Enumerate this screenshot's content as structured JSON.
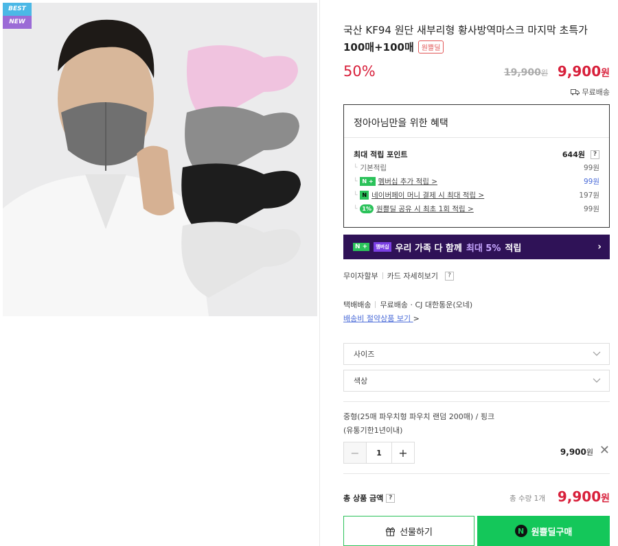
{
  "badges": {
    "best": "BEST",
    "new": "NEW"
  },
  "product": {
    "title_line1": "국산 KF94 원단 새부리형 황사방역마스크 마지막 초특가",
    "title_line2": "100매+100매",
    "tag": "원쁠딜",
    "discount": "50%",
    "original_price": "19,900",
    "original_unit": "원",
    "sale_price": "9,900",
    "sale_unit": "원",
    "shipping_badge": "무료배송"
  },
  "benefit": {
    "title": "정아아님만을 위한 혜택",
    "max_points_label": "최대 적립 포인트",
    "max_points_value": "644원",
    "help": "?",
    "rows": [
      {
        "label": "기본적립",
        "value": "99원"
      },
      {
        "label": "멤버십 추가 적립 >",
        "value": "99원",
        "pill": "N +"
      },
      {
        "label": "네이버페이 머니 결제 시 최대 적립 >",
        "value": "197원",
        "pill": "N"
      },
      {
        "label": "원쁠딜 공유 시 최초 1회 적립 >",
        "value": "99원",
        "pill": "1%"
      }
    ]
  },
  "banner": {
    "np": "N +",
    "mem": "멤버십",
    "text_pre": "우리 가족 다 함께",
    "text_hl": "최대 5%",
    "text_post": "적립",
    "chevron": "›"
  },
  "installment": {
    "label": "무이자할부",
    "link": "카드 자세히보기",
    "help": "?"
  },
  "delivery": {
    "label": "택배배송",
    "detail": "무료배송 · CJ 대한통운(오네)",
    "link": "배송비 절약상품 보기",
    "chevron": ">"
  },
  "options": {
    "size": "사이즈",
    "color": "색상"
  },
  "selected_option": {
    "line1": "중형(25매 파우치형 파우치 랜덤 200매) / 핑크",
    "line2": "(유통기한1년이내)",
    "minus": "−",
    "plus": "+",
    "quantity": "1",
    "price": "9,900",
    "unit": "원",
    "remove": "✕"
  },
  "total": {
    "label": "총 상품 금액",
    "help": "?",
    "count": "총 수량 1개",
    "price": "9,900",
    "unit": "원"
  },
  "actions": {
    "gift": "선물하기",
    "buy": "원쁠딜구매",
    "n_logo": "N"
  },
  "colors": {
    "accent_red": "#d8203b",
    "naver_green": "#14c75a",
    "banner_purple": "#2f1257"
  }
}
